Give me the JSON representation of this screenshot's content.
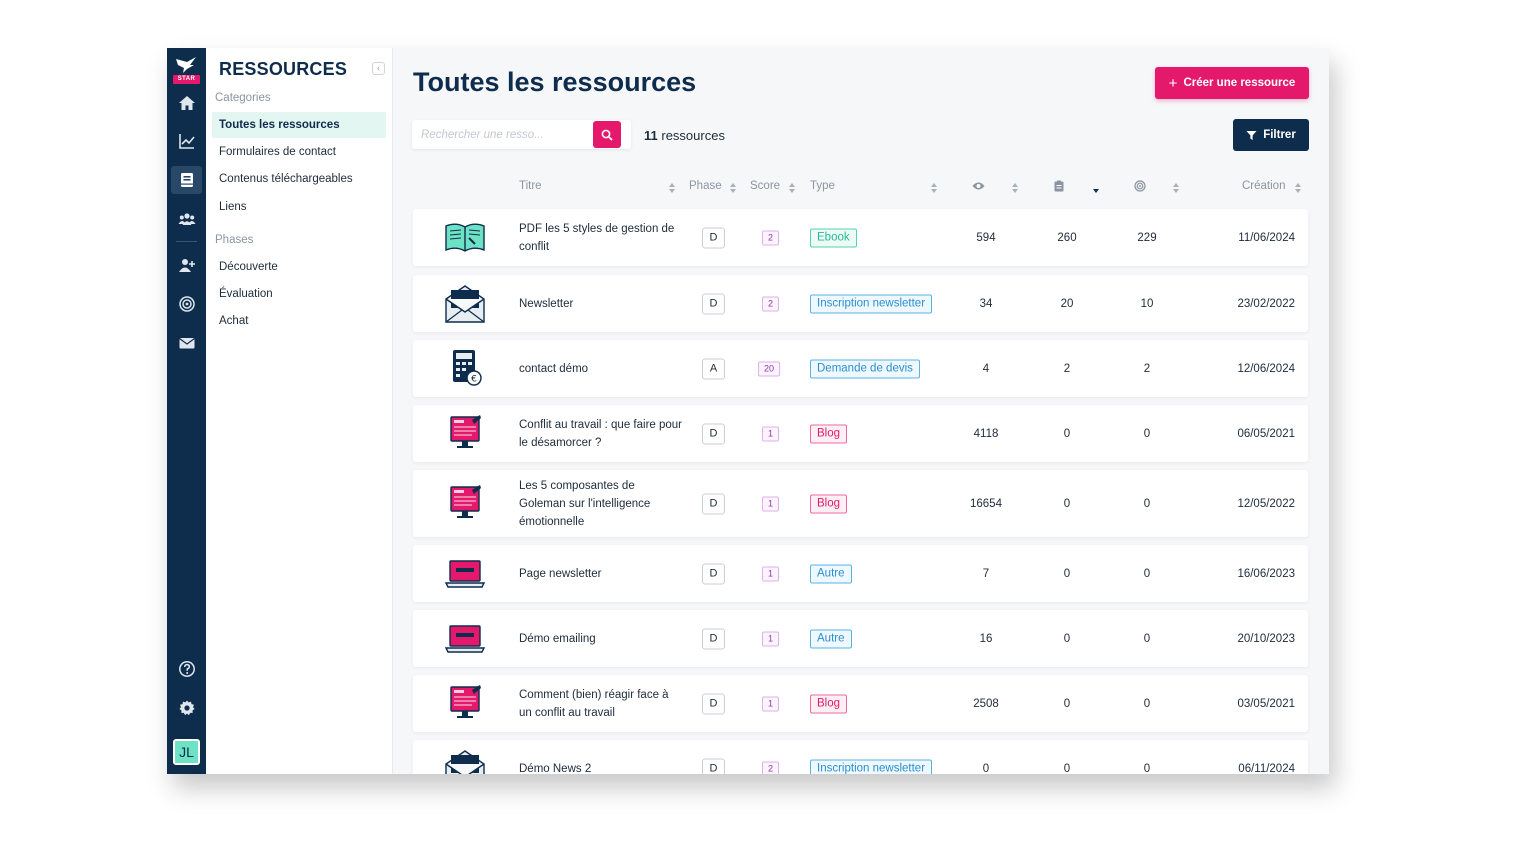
{
  "sidebar": {
    "title": "RESSOURCES",
    "logo_text": "STAR",
    "categories_heading": "Categories",
    "categories": [
      {
        "label": "Toutes les ressources",
        "active": true
      },
      {
        "label": "Formulaires de contact",
        "active": false
      },
      {
        "label": "Contenus téléchargeables",
        "active": false
      },
      {
        "label": "Liens",
        "active": false
      }
    ],
    "phases_heading": "Phases",
    "phases": [
      {
        "label": "Découverte"
      },
      {
        "label": "Évaluation"
      },
      {
        "label": "Achat"
      }
    ]
  },
  "rail": {
    "icons": [
      "home-icon",
      "chart-icon",
      "book-icon",
      "team-icon",
      "add-user-icon",
      "target-icon",
      "mail-icon",
      "help-icon",
      "settings-icon"
    ],
    "avatar_initials": "JL"
  },
  "header": {
    "title": "Toutes les ressources",
    "create_label": "Créer une ressource",
    "filter_label": "Filtrer"
  },
  "search": {
    "placeholder": "Rechercher une resso...",
    "value": ""
  },
  "count": {
    "number": "11",
    "label": "ressources"
  },
  "table": {
    "columns": {
      "title": "Titre",
      "phase": "Phase",
      "score": "Score",
      "type": "Type",
      "views_icon": "eye-icon",
      "downloads_icon": "clipboard-icon",
      "targets_icon": "target-icon",
      "created": "Création"
    },
    "rows": [
      {
        "thumb": "ebook",
        "title": "PDF les 5 styles de gestion de conflit",
        "phase": "D",
        "score": "2",
        "type": "Ebook",
        "type_style": "ebook",
        "views": "594",
        "downloads": "260",
        "targets": "229",
        "date": "11/06/2024"
      },
      {
        "thumb": "envelope",
        "title": "Newsletter",
        "phase": "D",
        "score": "2",
        "type": "Inscription newsletter",
        "type_style": "blue",
        "views": "34",
        "downloads": "20",
        "targets": "10",
        "date": "23/02/2022"
      },
      {
        "thumb": "calculator",
        "title": "contact démo",
        "phase": "A",
        "score": "20",
        "type": "Demande de devis",
        "type_style": "blue",
        "views": "4",
        "downloads": "2",
        "targets": "2",
        "date": "12/06/2024"
      },
      {
        "thumb": "blog",
        "title": "Conflit au travail : que faire pour le désamorcer ?",
        "phase": "D",
        "score": "1",
        "type": "Blog",
        "type_style": "blog",
        "views": "4118",
        "downloads": "0",
        "targets": "0",
        "date": "06/05/2021"
      },
      {
        "thumb": "blog",
        "title": "Les 5 composantes de Goleman sur l'intelligence émotionnelle",
        "phase": "D",
        "score": "1",
        "type": "Blog",
        "type_style": "blog",
        "views": "16654",
        "downloads": "0",
        "targets": "0",
        "date": "12/05/2022"
      },
      {
        "thumb": "laptop",
        "title": "Page newsletter",
        "phase": "D",
        "score": "1",
        "type": "Autre",
        "type_style": "blue",
        "views": "7",
        "downloads": "0",
        "targets": "0",
        "date": "16/06/2023"
      },
      {
        "thumb": "laptop",
        "title": "Démo emailing",
        "phase": "D",
        "score": "1",
        "type": "Autre",
        "type_style": "blue",
        "views": "16",
        "downloads": "0",
        "targets": "0",
        "date": "20/10/2023"
      },
      {
        "thumb": "blog",
        "title": "Comment (bien) réagir face à un conflit au travail",
        "phase": "D",
        "score": "1",
        "type": "Blog",
        "type_style": "blog",
        "views": "2508",
        "downloads": "0",
        "targets": "0",
        "date": "03/05/2021"
      },
      {
        "thumb": "envelope",
        "title": "Démo News 2",
        "phase": "D",
        "score": "2",
        "type": "Inscription newsletter",
        "type_style": "blue",
        "views": "0",
        "downloads": "0",
        "targets": "0",
        "date": "06/11/2024"
      }
    ]
  },
  "colors": {
    "navy": "#0e2c4c",
    "pink": "#e4196b",
    "mint": "#6ee2c4"
  }
}
